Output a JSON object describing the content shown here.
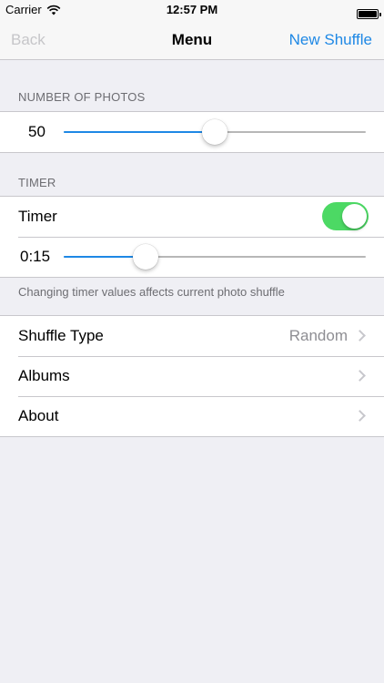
{
  "status_bar": {
    "carrier": "Carrier",
    "time": "12:57 PM"
  },
  "nav": {
    "back": "Back",
    "title": "Menu",
    "right": "New Shuffle"
  },
  "photos": {
    "header": "NUMBER OF PHOTOS",
    "value_label": "50",
    "slider_fraction": 0.5
  },
  "timer": {
    "header": "TIMER",
    "toggle_label": "Timer",
    "toggle_on": true,
    "value_label": "0:15",
    "slider_fraction": 0.27,
    "note": "Changing timer values affects current photo shuffle"
  },
  "menu": {
    "shuffle_type_label": "Shuffle Type",
    "shuffle_type_value": "Random",
    "albums_label": "Albums",
    "about_label": "About"
  },
  "colors": {
    "accent": "#1e88e5",
    "toggle_on": "#4cd964",
    "background": "#efeff4"
  },
  "icons": [
    "wifi-icon",
    "battery-icon",
    "chevron-right-icon"
  ]
}
